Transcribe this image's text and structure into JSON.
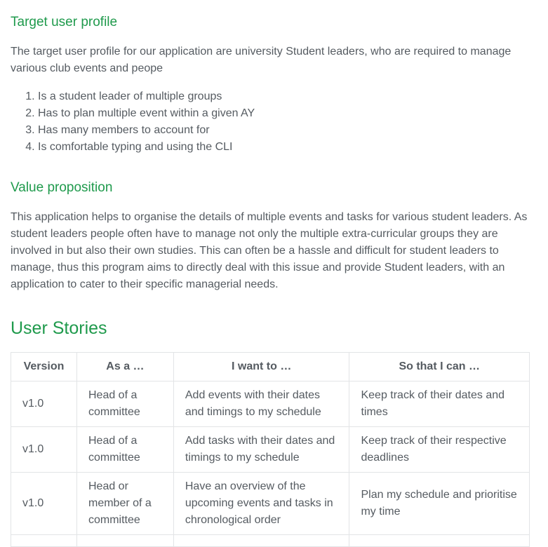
{
  "sections": {
    "target": {
      "heading": "Target user profile",
      "intro": "The target user profile for our application are university Student leaders, who are required to manage various club events and peope",
      "items": [
        "Is a student leader of multiple groups",
        "Has to plan multiple event within a given AY",
        "Has many members to account for",
        "Is comfortable typing and using the CLI"
      ]
    },
    "value": {
      "heading": "Value proposition",
      "body": "This application helps to organise the details of multiple events and tasks for various student leaders. As student leaders people often have to manage not only the multiple extra-curricular groups they are involved in but also their own studies. This can often be a hassle and difficult for student leaders to manage, thus this program aims to directly deal with this issue and provide Student leaders, with an application to cater to their specific managerial needs."
    },
    "stories": {
      "heading": "User Stories",
      "columns": [
        "Version",
        "As a …",
        "I want to …",
        "So that I can …"
      ],
      "rows": [
        [
          "v1.0",
          "Head of a committee",
          "Add events with their dates and timings to my schedule",
          "Keep track of their dates and times"
        ],
        [
          "v1.0",
          "Head of a committee",
          "Add tasks with their dates and timings to my schedule",
          "Keep track of their respective deadlines"
        ],
        [
          "v1.0",
          "Head or member of a committee",
          "Have an overview of the upcoming events and tasks in chronological order",
          "Plan my schedule and prioritise my time"
        ],
        [
          "",
          "",
          "",
          ""
        ]
      ]
    }
  },
  "colors": {
    "heading": "#1f9a4c",
    "text": "#555b61",
    "border": "#e2e4e6"
  }
}
